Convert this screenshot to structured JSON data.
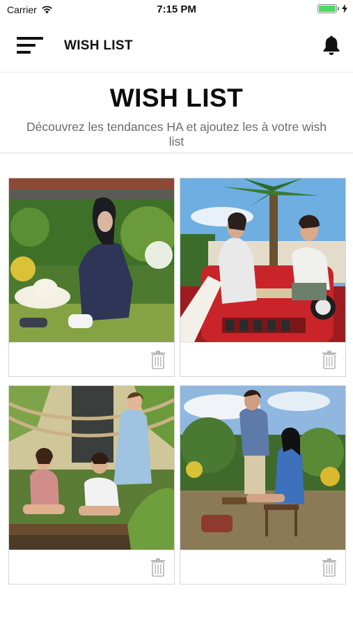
{
  "status_bar": {
    "carrier": "Carrier",
    "time": "7:15 PM"
  },
  "nav": {
    "title": "WISH LIST",
    "menu_icon": "hamburger-menu-icon",
    "notification_icon": "bell-icon"
  },
  "header": {
    "title": "WISH LIST",
    "subtitle": "Découvrez les tendances HA et ajoutez les à votre wish list"
  },
  "wishlist": {
    "items": [
      {
        "image": "woman-with-sun-hat-in-garden-photo",
        "action_icon": "trash-icon"
      },
      {
        "image": "couple-on-red-jeep-playing-chess-photo",
        "action_icon": "trash-icon"
      },
      {
        "image": "children-on-wooden-bridge-photo",
        "action_icon": "trash-icon"
      },
      {
        "image": "couple-in-denim-on-bench-photo",
        "action_icon": "trash-icon"
      }
    ]
  },
  "colors": {
    "background": "#ffffff",
    "title": "#0a0a0a",
    "subtitle": "#6b6b6b",
    "border": "#d4d4d4",
    "icon_gray": "#b5b5b5",
    "battery": "#4cd964"
  }
}
